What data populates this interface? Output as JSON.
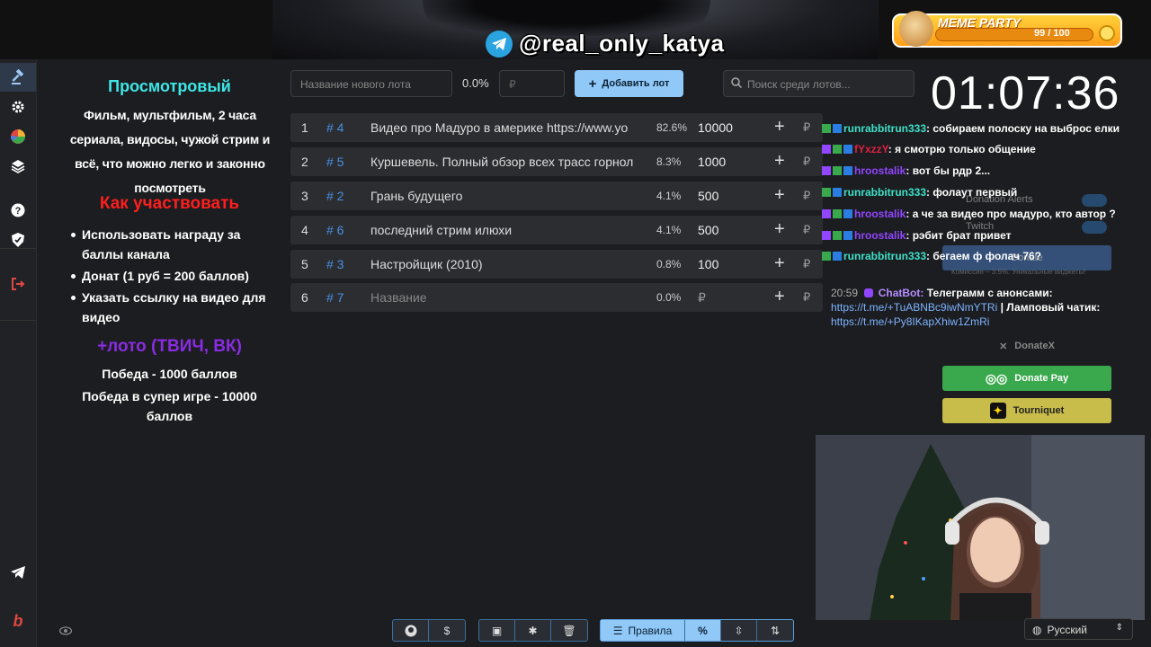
{
  "banner": {
    "telegram_handle": "@real_only_katya"
  },
  "meme_party": {
    "title": "MEME PARTY",
    "count": "99 / 100",
    "progress": 0.99
  },
  "sidebar": {
    "items": [
      "gavel-icon",
      "gear-icon",
      "pie-chart-icon",
      "layers-icon",
      "help-icon",
      "shield-icon",
      "logout-icon",
      "telegram-icon",
      "brand-b-icon"
    ]
  },
  "left_panel": {
    "title": "Просмотровый",
    "description": "Фильм, мультфильм, 2 часа сериала, видосы, чужой стрим и всё, что можно легко и законно посмотреть",
    "how_title": "Как участвовать",
    "how_items": [
      "Использовать награду за баллы канала",
      "Донат (1 руб = 200 баллов)",
      "Указать ссылку на видео для видео"
    ],
    "loto_title": "+лото (ТВИЧ, ВК)",
    "win1": "Победа - 1000 баллов",
    "win2": "Победа в супер игре - 10000 баллов"
  },
  "toolbar": {
    "new_lot_placeholder": "Название нового лота",
    "percent": "0.0%",
    "rub_placeholder": "₽",
    "add_label": "Добавить лот",
    "search_placeholder": "Поиск среди лотов..."
  },
  "lots": [
    {
      "n": "1",
      "id": "# 4",
      "title": "Видео про Мадуро в америке https://www.yo",
      "pct": "82.6%",
      "value": "10000",
      "cur": "₽"
    },
    {
      "n": "2",
      "id": "# 5",
      "title": "Куршевель. Полный обзор всех трасс горнол",
      "pct": "8.3%",
      "value": "1000",
      "cur": "₽"
    },
    {
      "n": "3",
      "id": "# 2",
      "title": "Грань будущего",
      "pct": "4.1%",
      "value": "500",
      "cur": "₽"
    },
    {
      "n": "4",
      "id": "# 6",
      "title": "последний стрим илюхи",
      "pct": "4.1%",
      "value": "500",
      "cur": "₽"
    },
    {
      "n": "5",
      "id": "# 3",
      "title": "Настройщик (2010)",
      "pct": "0.8%",
      "value": "100",
      "cur": "₽"
    },
    {
      "n": "6",
      "id": "# 7",
      "title": "Название",
      "pct": "0.0%",
      "value": "₽",
      "cur": "₽"
    }
  ],
  "timer": "01:07:36",
  "chat": [
    {
      "user": "runrabbitrun333",
      "color": "#3ee0c8",
      "text": ": собираем полоску на выброс елки"
    },
    {
      "user": "fYxzzY",
      "color": "#e02040",
      "text": ": я смотрю только общение"
    },
    {
      "user": "hroostalik",
      "color": "#9146ff",
      "text": ": вот бы рдр 2..."
    },
    {
      "user": "runrabbitrun333",
      "color": "#3ee0c8",
      "text": ": фолаут первый"
    },
    {
      "user": "hroostalik",
      "color": "#9146ff",
      "text": ": а че за видео про мадуро, кто автор ?"
    },
    {
      "user": "hroostalik",
      "color": "#9146ff",
      "text": ": рэбит брат привет"
    },
    {
      "user": "runrabbitrun333",
      "color": "#3ee0c8",
      "text": ": бегаем ф фолач 76?"
    }
  ],
  "chatbot": {
    "time": "20:59",
    "name": "ChatBot:",
    "text": "Телеграмм с анонсами:",
    "link1": "https://t.me/+TuABNBc9iwNmYTRi",
    "text2": " | Ламповый чатик: ",
    "link2": "https://t.me/+Py8IKapXhiw1ZmRi"
  },
  "ghost": {
    "donation_alerts": "Donation Alerts",
    "twitch": "Twitch",
    "donate": "Donate",
    "commission": "Комиссия – 3.5%. Уникальные виджеты!",
    "donatex": "DonateX"
  },
  "right_buttons": {
    "donatepay": "Donate Pay",
    "tourniquet": "Tourniquet"
  },
  "language": "Русский",
  "bottom_toolbar": {
    "rules_label": "Правила"
  },
  "colors": {
    "accent": "#90c8f8",
    "cyan": "#3ee6e6",
    "red": "#ff1e1e",
    "purple": "#8a2be2",
    "donatepay": "#3aa94d",
    "tourniquet": "#c8bc4a"
  }
}
